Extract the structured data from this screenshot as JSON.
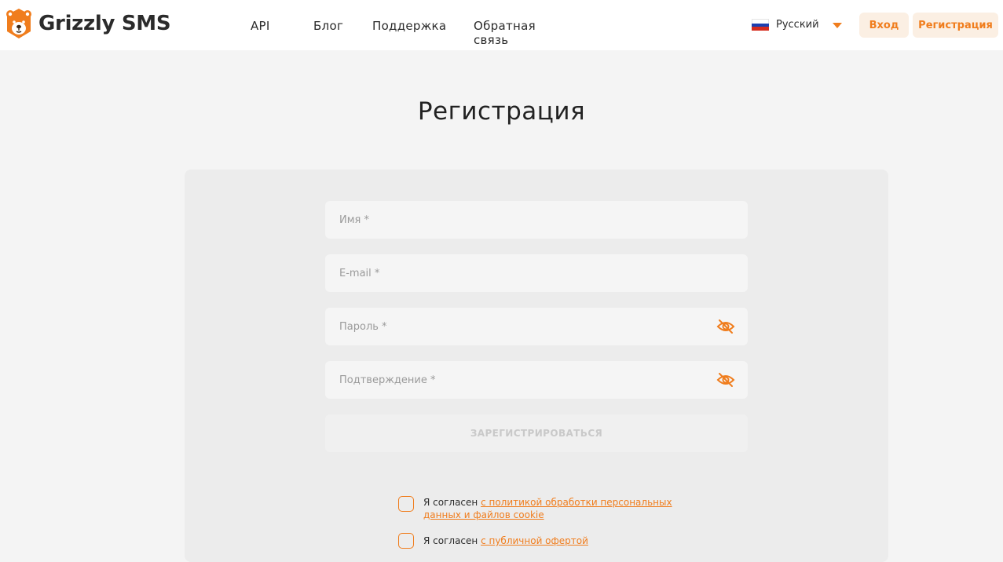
{
  "header": {
    "logo_text": "Grizzly SMS",
    "nav": [
      {
        "label": "API"
      },
      {
        "label": "Блог"
      },
      {
        "label": "Поддержка"
      },
      {
        "label": "Обратная связь"
      }
    ],
    "language": "Русский",
    "login_label": "Вход",
    "register_label": "Регистрация"
  },
  "main": {
    "title": "Регистрация",
    "fields": {
      "name_placeholder": "Имя *",
      "email_placeholder": "E-mail *",
      "password_placeholder": "Пароль *",
      "confirm_placeholder": "Подтверждение *"
    },
    "submit_label": "ЗАРЕГИСТРИРОВАТЬСЯ",
    "agreements": [
      {
        "prefix": "Я согласен ",
        "link": "с политикой обработки персональных данных и файлов cookie"
      },
      {
        "prefix": "Я согласен ",
        "link": "с публичной офертой"
      }
    ]
  },
  "colors": {
    "accent": "#f07d1d",
    "accent_bg": "#fbefe3",
    "page_bg": "#f4f4f4",
    "card_bg": "#ececec"
  },
  "icons": [
    "bear-logo-icon",
    "russia-flag-icon",
    "caret-down-icon",
    "eye-off-icon"
  ]
}
